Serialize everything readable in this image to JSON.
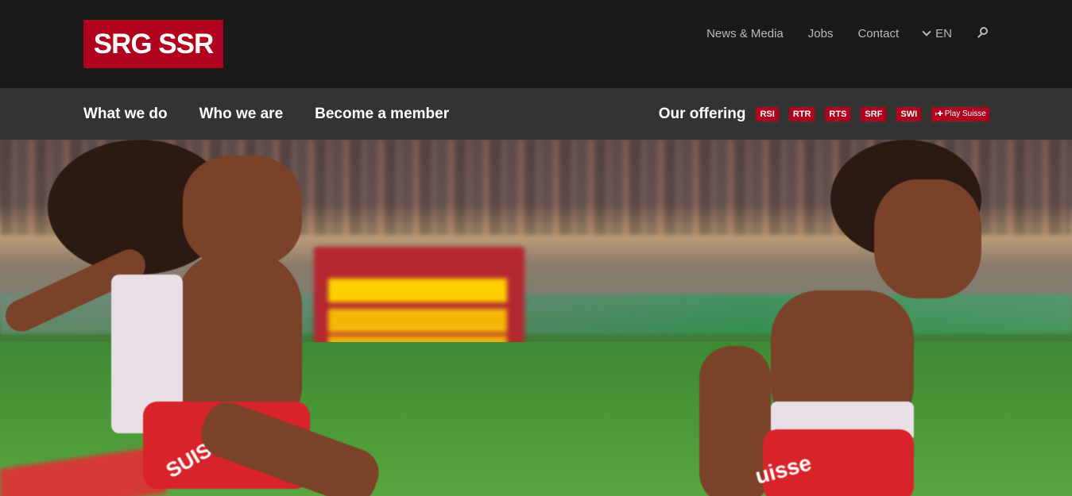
{
  "header": {
    "logo_text": "SRG SSR",
    "utility_nav": [
      {
        "label": "News & Media"
      },
      {
        "label": "Jobs"
      },
      {
        "label": "Contact"
      }
    ],
    "language": "EN",
    "search_icon": "search-icon"
  },
  "main_nav": {
    "items": [
      {
        "label": "What we do"
      },
      {
        "label": "Who we are"
      },
      {
        "label": "Become a member"
      }
    ],
    "offering_label": "Our offering",
    "offering_badges": [
      {
        "label": "RSI"
      },
      {
        "label": "RTR"
      },
      {
        "label": "RTS"
      },
      {
        "label": "SRF"
      },
      {
        "label": "SWI"
      },
      {
        "label": "Play Suisse"
      }
    ]
  },
  "hero": {
    "kit_text_left": "SUISSE",
    "kit_text_right": "uisse"
  },
  "colors": {
    "brand_red": "#af001d",
    "top_bar": "#1a1a1a",
    "nav_bar": "#333333"
  }
}
